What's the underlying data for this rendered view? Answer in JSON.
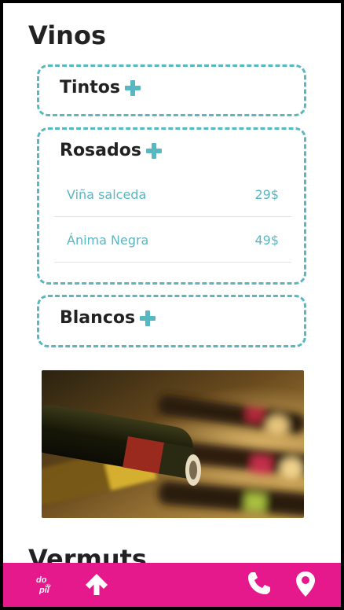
{
  "menu": {
    "section_title": "Vinos",
    "categories": [
      {
        "label": "Tintos"
      },
      {
        "label": "Rosados",
        "items": [
          {
            "name": "Viña salceda",
            "price": "29$"
          },
          {
            "name": "Ánima Negra",
            "price": "49$"
          }
        ]
      },
      {
        "label": "Blancos"
      }
    ],
    "next_section_title": "Vermuts"
  },
  "bottom_bar": {
    "logo_text_top": "do",
    "logo_text_mid": "de",
    "logo_text_bottom": "pil"
  },
  "icons": {
    "expand": "plus-icon",
    "scroll_top": "arrow-up-icon",
    "call": "phone-icon",
    "location": "map-pin-icon",
    "photo": "wine-bottles-photo"
  },
  "colors": {
    "accent": "#59b7c2",
    "bottom_bar": "#e5198b",
    "text": "#222222"
  }
}
